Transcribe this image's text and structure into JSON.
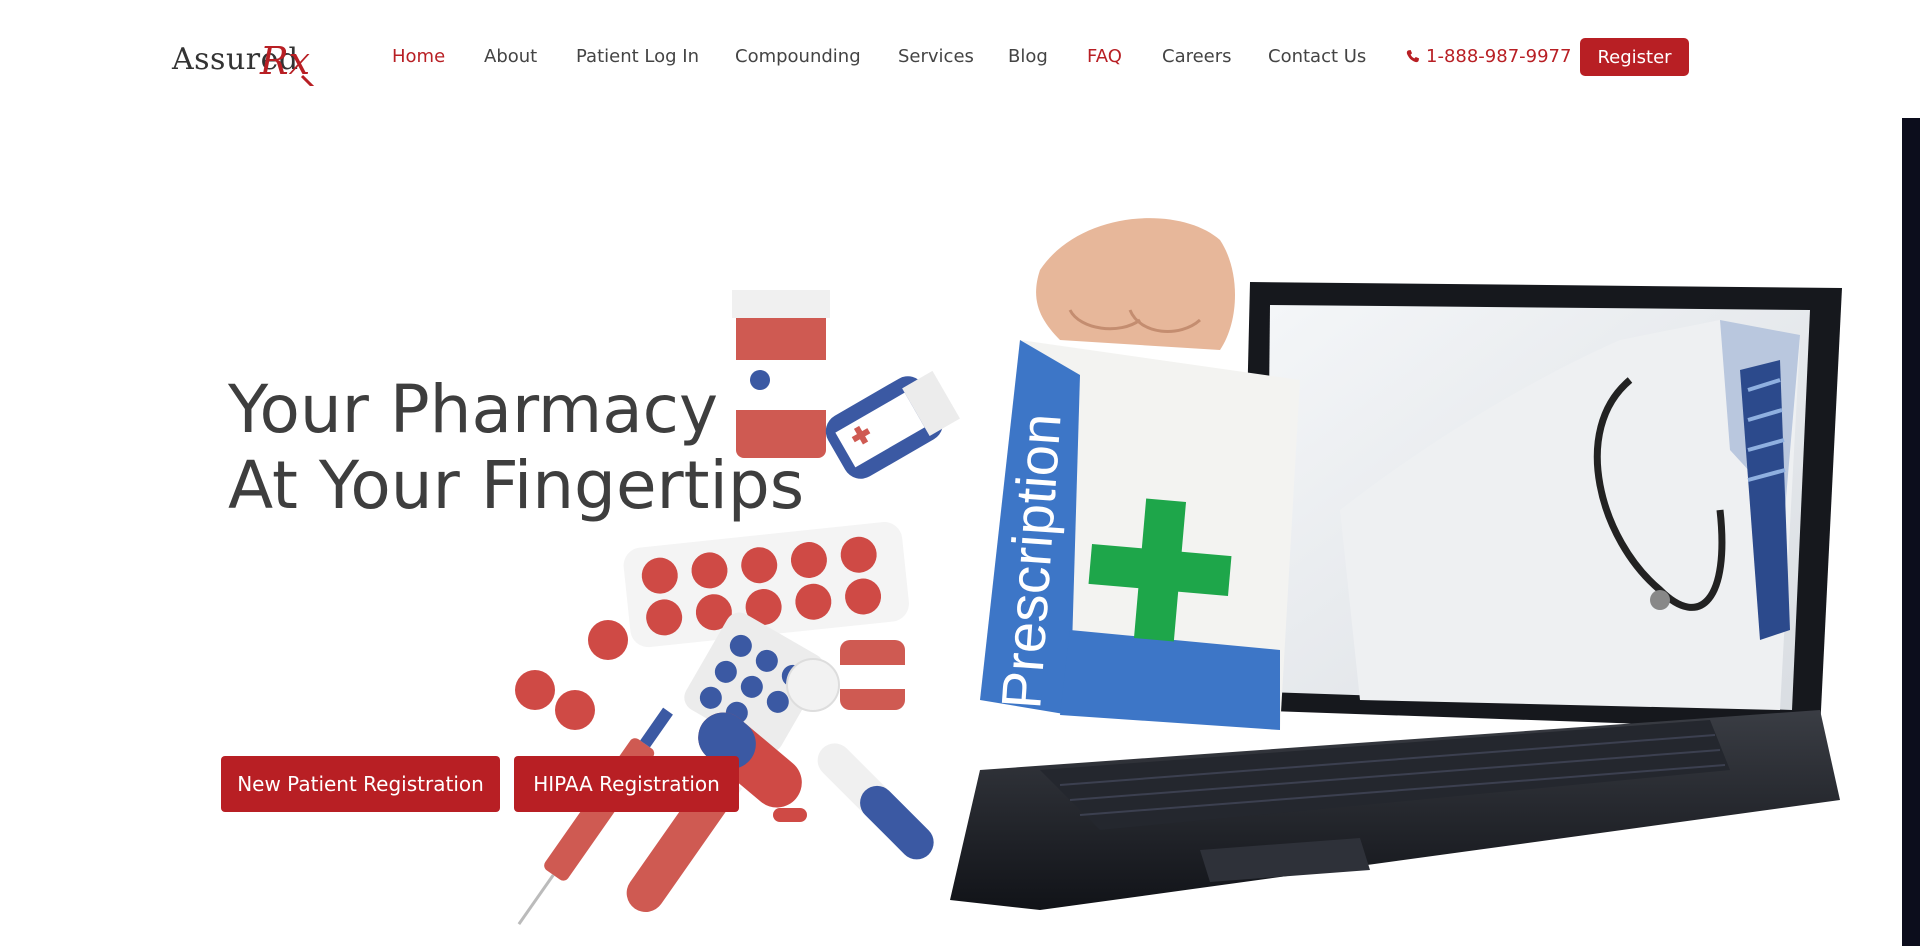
{
  "brand": {
    "name": "Assured",
    "mark": "Rx",
    "color_primary": "#b81f24",
    "color_text": "#444444"
  },
  "nav": {
    "items": [
      {
        "label": "Home",
        "active": true
      },
      {
        "label": "About"
      },
      {
        "label": "Patient Log In"
      },
      {
        "label": "Compounding"
      },
      {
        "label": "Services"
      },
      {
        "label": "Blog"
      },
      {
        "label": "FAQ",
        "highlight": true
      },
      {
        "label": "Careers"
      },
      {
        "label": "Contact Us"
      }
    ],
    "phone": "1-888-987-9977",
    "phone_icon": "phone-icon",
    "register_label": "Register"
  },
  "hero": {
    "headline_line1": "Your Pharmacy",
    "headline_line2": "At Your Fingertips",
    "cta_new_patient": "New Patient Registration",
    "cta_hipaa": "HIPAA Registration",
    "bag_label": "Prescription"
  }
}
